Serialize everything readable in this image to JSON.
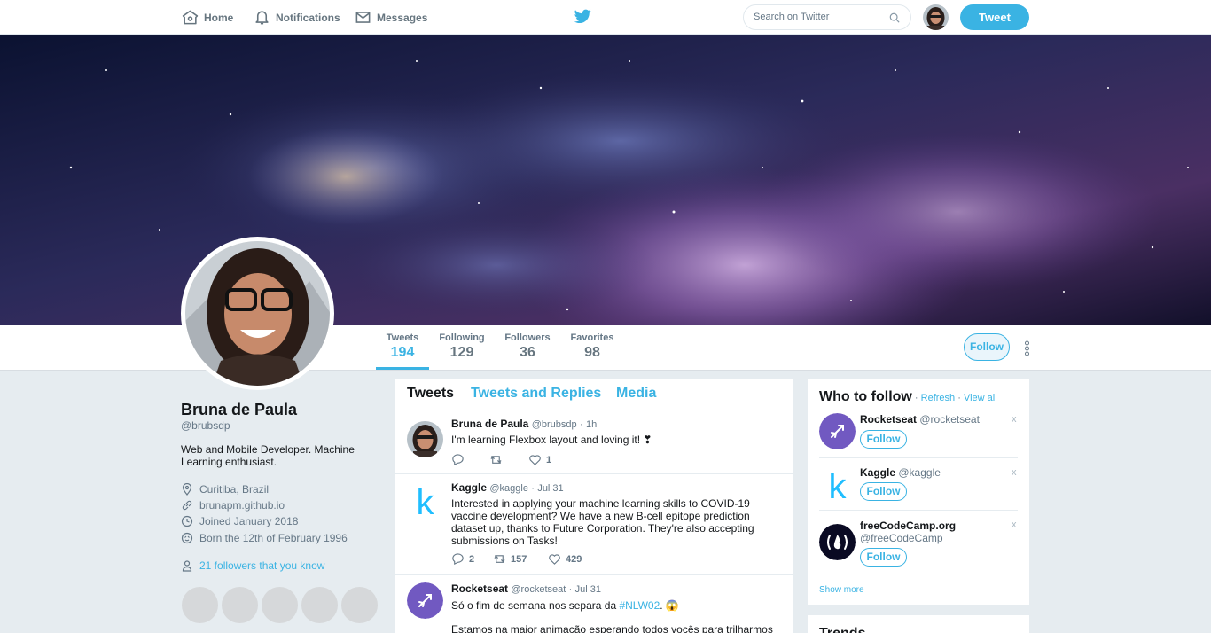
{
  "nav": {
    "home": "Home",
    "notifications": "Notifications",
    "messages": "Messages",
    "search_placeholder": "Search on Twitter",
    "tweet_button": "Tweet"
  },
  "profile_nav": {
    "stats": [
      {
        "label": "Tweets",
        "value": "194"
      },
      {
        "label": "Following",
        "value": "129"
      },
      {
        "label": "Followers",
        "value": "36"
      },
      {
        "label": "Favorites",
        "value": "98"
      }
    ],
    "follow_button": "Follow"
  },
  "profile": {
    "name": "Bruna de Paula",
    "handle": "@brubsdp",
    "bio": "Web and Mobile Developer. Machine Learning enthusiast.",
    "location": "Curitiba, Brazil",
    "website": "brunapm.github.io",
    "joined": "Joined January 2018",
    "born": "Born the 12th of February 1996",
    "followers_you_know": "21 followers that you know"
  },
  "timeline": {
    "tabs": [
      "Tweets",
      "Tweets and Replies",
      "Media"
    ],
    "tweets": [
      {
        "name": "Bruna de Paula",
        "handle": "@brubsdp",
        "time": "1h",
        "text": "I'm learning Flexbox layout and loving it! ❣",
        "replies": "",
        "retweets": "",
        "likes": "1"
      },
      {
        "name": "Kaggle",
        "handle": "@kaggle",
        "time": "Jul 31",
        "text": "Interested in applying your machine learning skills to COVID-19 vaccine development? We have a new B-cell epitope prediction dataset up, thanks to Future Corporation. They're also accepting submissions on Tasks!",
        "replies": "2",
        "retweets": "157",
        "likes": "429"
      },
      {
        "name": "Rocketseat",
        "handle": "@rocketseat",
        "time": "Jul 31",
        "text_before": "Só o fim de semana nos separa da ",
        "hashtag": "#NLW02",
        "text_after": ". 😱",
        "text_line2": "Estamos na maior animação esperando todos vocês para trilharmos"
      }
    ]
  },
  "who_to_follow": {
    "title": "Who to follow",
    "refresh": "Refresh",
    "view_all": "View all",
    "suggestions": [
      {
        "name": "Rocketseat",
        "handle": "@rocketseat",
        "follow": "Follow",
        "close": "x"
      },
      {
        "name": "Kaggle",
        "handle": "@kaggle",
        "follow": "Follow",
        "close": "x"
      },
      {
        "name": "freeCodeCamp.org",
        "handle": "@freeCodeCamp",
        "follow": "Follow",
        "close": "x"
      }
    ],
    "show_more": "Show more"
  },
  "trends": {
    "title": "Trends"
  },
  "colors": {
    "accent": "#3ab3e3",
    "text": "#14171a",
    "muted": "#657786",
    "background": "#e6ecf0"
  }
}
